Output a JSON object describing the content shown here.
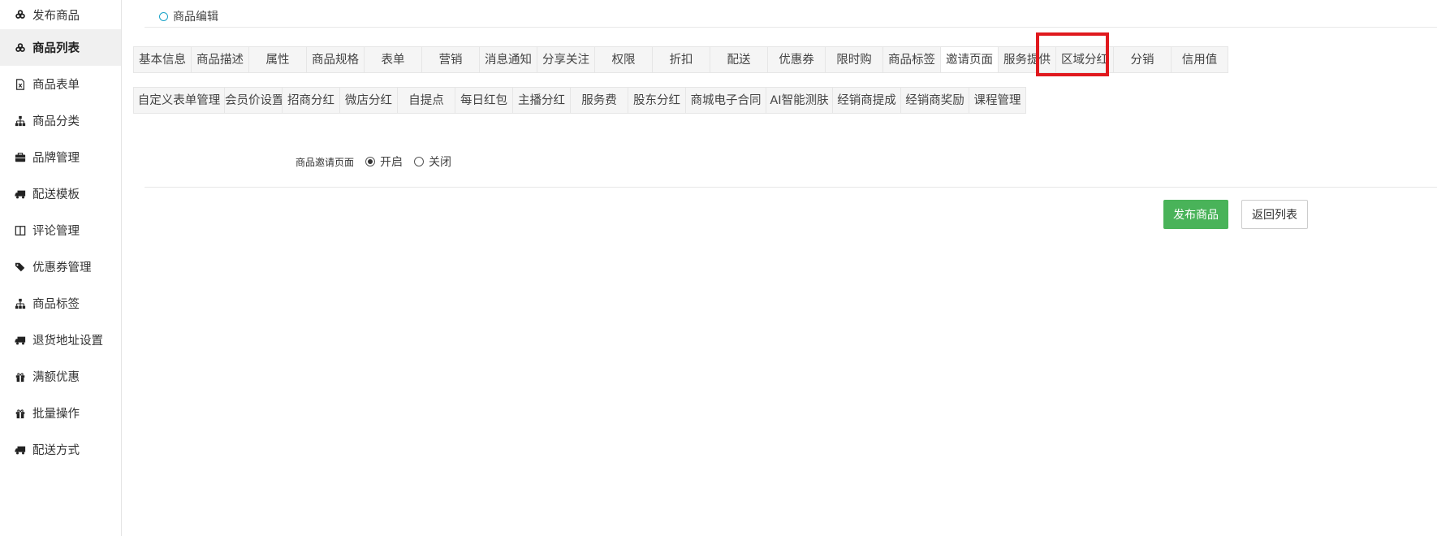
{
  "sidebar": {
    "items": [
      {
        "label": "发布商品",
        "icon": "cubes-icon"
      },
      {
        "label": "商品列表",
        "icon": "cubes-icon",
        "active": true
      },
      {
        "label": "商品表单",
        "icon": "file-excel-icon"
      },
      {
        "label": "商品分类",
        "icon": "sitemap-icon"
      },
      {
        "label": "品牌管理",
        "icon": "briefcase-icon"
      },
      {
        "label": "配送模板",
        "icon": "truck-icon"
      },
      {
        "label": "评论管理",
        "icon": "columns-icon"
      },
      {
        "label": "优惠券管理",
        "icon": "tags-icon"
      },
      {
        "label": "商品标签",
        "icon": "sitemap-icon"
      },
      {
        "label": "退货地址设置",
        "icon": "truck-icon"
      },
      {
        "label": "满额优惠",
        "icon": "gift-icon"
      },
      {
        "label": "批量操作",
        "icon": "gift-icon"
      },
      {
        "label": "配送方式",
        "icon": "truck-icon"
      }
    ]
  },
  "breadcrumb": {
    "label": "商品编辑"
  },
  "tabs_row1": [
    "基本信息",
    "商品描述",
    "属性",
    "商品规格",
    "表单",
    "营销",
    "消息通知",
    "分享关注",
    "权限",
    "折扣",
    "配送",
    "优惠券",
    "限时购",
    "商品标签",
    "邀请页面",
    "服务提供",
    "区域分红",
    "分销",
    "信用值"
  ],
  "tabs_row2": [
    "自定义表单管理",
    "会员价设置",
    "招商分红",
    "微店分红",
    "自提点",
    "每日红包",
    "主播分红",
    "服务费",
    "股东分红",
    "商城电子合同",
    "AI智能测肤",
    "经销商提成",
    "经销商奖励",
    "课程管理"
  ],
  "active_tab": "邀请页面",
  "form": {
    "label": "商品邀请页面",
    "options": [
      {
        "label": "开启",
        "checked": true
      },
      {
        "label": "关闭",
        "checked": false
      }
    ]
  },
  "buttons": {
    "publish": "发布商品",
    "back": "返回列表"
  },
  "colors": {
    "accent_green": "#49b359",
    "highlight_red": "#e0191e",
    "breadcrumb_circle": "#1aa3c8"
  }
}
